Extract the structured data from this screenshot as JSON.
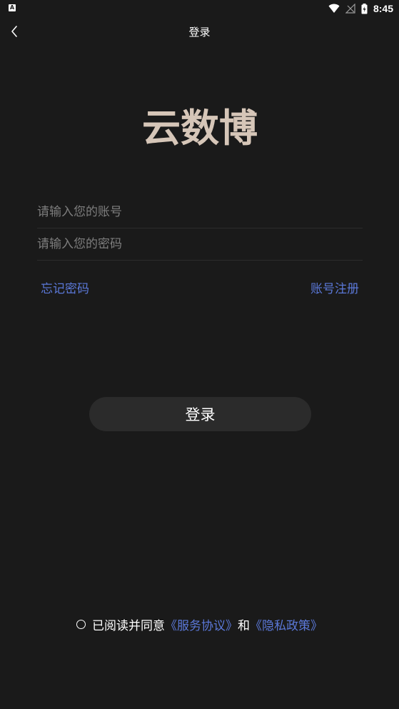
{
  "status_bar": {
    "left_icon": "a-icon",
    "time": "8:45",
    "icons": [
      "wifi-icon",
      "no-signal-icon",
      "battery-icon"
    ]
  },
  "title_bar": {
    "back_icon": "back-chevron-icon",
    "title": "登录"
  },
  "logo": {
    "text": "云数博",
    "color": "#d6c6b8"
  },
  "form": {
    "account_placeholder": "请输入您的账号",
    "account_value": "",
    "password_placeholder": "请输入您的密码",
    "password_value": ""
  },
  "links": {
    "forgot_password": "忘记密码",
    "register": "账号注册"
  },
  "login_button": {
    "label": "登录"
  },
  "agreement": {
    "checked": false,
    "prefix": "已阅读并同意",
    "service_link": "《服务协议》",
    "conjunction": "和",
    "privacy_link": "《隐私政策》"
  },
  "colors": {
    "background": "#1a1a1a",
    "link": "#5b78d8",
    "button": "#2b2b2b",
    "placeholder": "#7d7d7d"
  }
}
